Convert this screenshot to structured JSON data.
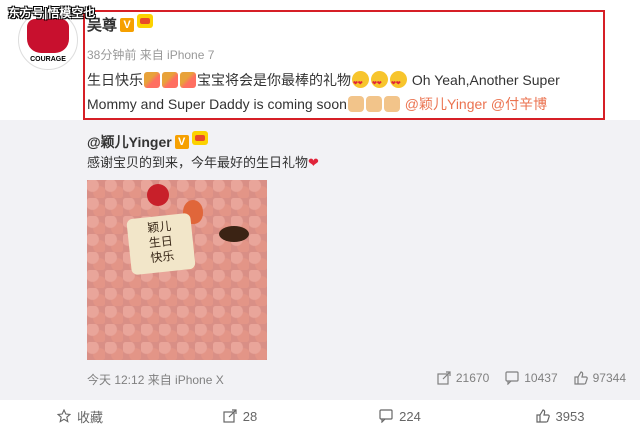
{
  "watermark": "东方号|悟模空也",
  "post": {
    "username": "吴尊",
    "time": "38分钟前",
    "source": "来自 iPhone 7",
    "text_part1": "生日快乐",
    "text_part2": "宝宝将会是你最棒的礼物",
    "text_part3": "Oh Yeah,Another Super Mommy and Super Daddy is coming soon",
    "mention1": "@颖儿Yinger",
    "mention2": "@付辛博",
    "avatar_text": "COURAGE"
  },
  "repost": {
    "username": "@颖儿Yinger",
    "text": "感谢宝贝的到来，今年最好的生日礼物",
    "cake_text": [
      "颖儿",
      "生日",
      "快乐"
    ],
    "footer": "今天 12:12 来自 iPhone X",
    "reposts": "21670",
    "comments": "10437",
    "likes": "97344"
  },
  "actions": {
    "favorite": "收藏",
    "repost": "28",
    "comment": "224",
    "like": "3953"
  },
  "colors": {
    "highlight": "#d61f26",
    "mention": "#eb7350",
    "repost_bg": "#f2f2f5"
  }
}
